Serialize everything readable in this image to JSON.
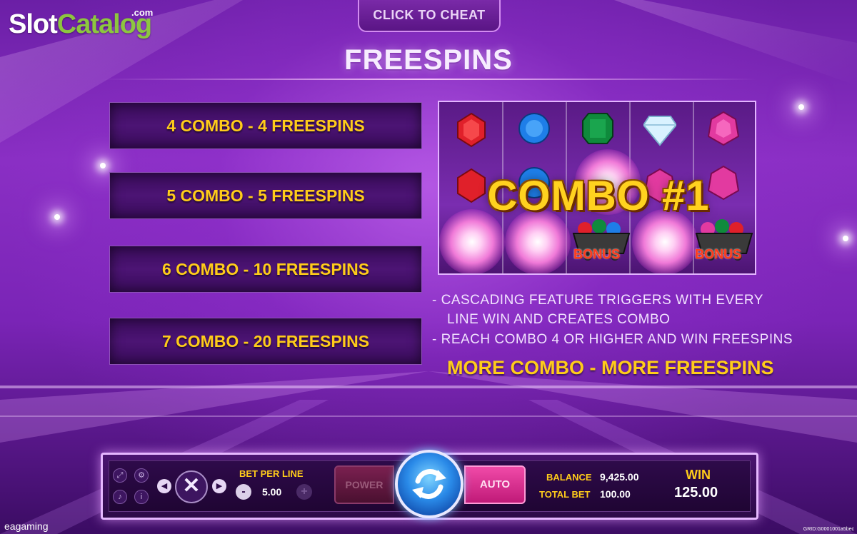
{
  "logo": {
    "slot": "Slot",
    "catalog": "Catalog",
    "com": ".com"
  },
  "cheat_button": "CLICK TO CHEAT",
  "title": "FREESPINS",
  "combos": [
    {
      "label": "4 COMBO - 4 FREESPINS"
    },
    {
      "label": "5 COMBO - 5 FREESPINS"
    },
    {
      "label": "6 COMBO - 10 FREESPINS"
    },
    {
      "label": "7 COMBO - 20 FREESPINS"
    }
  ],
  "preview": {
    "combo_text": "COMBO #1",
    "bonus_label": "BONUS",
    "gems_row1": [
      "red-gem",
      "blue-gem",
      "green-gem",
      "white-diamond",
      "pink-gem"
    ],
    "colors": {
      "red": "#e0202a",
      "blue": "#1e7ee8",
      "green": "#0f8a3c",
      "white": "#d9f2ff",
      "pink": "#e23aa0"
    }
  },
  "description": {
    "line1": "- CASCADING FEATURE TRIGGERS WITH EVERY",
    "line2": "LINE WIN AND CREATES COMBO",
    "line3": "- REACH COMBO 4 OR HIGHER AND WIN FREESPINS",
    "highlight": "MORE COMBO - MORE FREESPINS"
  },
  "controls": {
    "icons": [
      "fullscreen-icon",
      "gear-icon",
      "mute-icon",
      "info-icon"
    ],
    "bet_per_line_label": "BET PER LINE",
    "bet_per_line_value": "5.00",
    "minus": "-",
    "plus": "+",
    "power": "POWER",
    "auto": "AUTO",
    "balance_label": "BALANCE",
    "balance_value": "9,425.00",
    "total_bet_label": "TOTAL BET",
    "total_bet_value": "100.00",
    "win_label": "WIN",
    "win_value": "125.00"
  },
  "footer": {
    "brand": "eagaming",
    "grid": "GRID:G0001001a5bec"
  },
  "accent": "#ffcc1a"
}
